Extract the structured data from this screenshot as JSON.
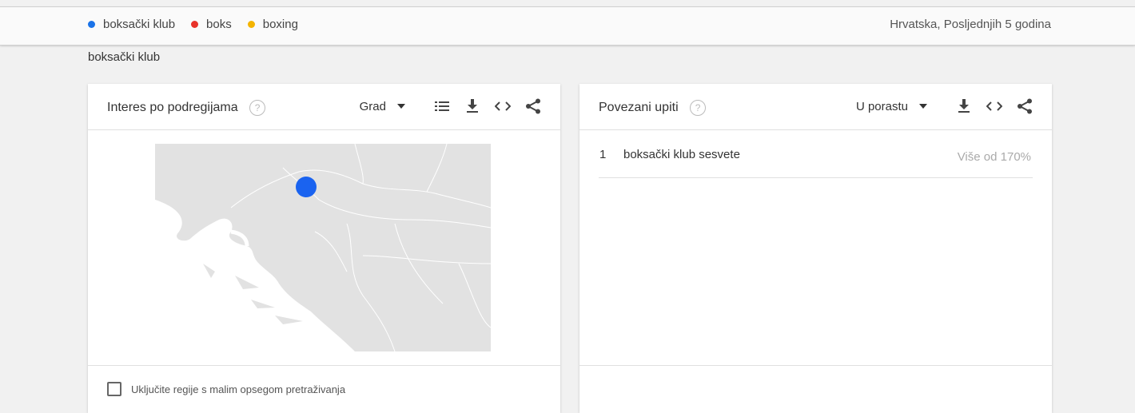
{
  "legend": [
    {
      "label": "boksački klub",
      "color": "#1a73e8"
    },
    {
      "label": "boks",
      "color": "#e8332a"
    },
    {
      "label": "boxing",
      "color": "#f4b400"
    }
  ],
  "filter_text": "Hrvatska, Posljednjih 5 godina",
  "term_label": "boksački klub",
  "left_card": {
    "title": "Interes po podregijama",
    "help_icon": "help-circle-icon",
    "dropdown_label": "Grad",
    "icons": [
      "list-icon",
      "download-icon",
      "embed-icon",
      "share-icon"
    ],
    "map": {
      "region": "Croatia",
      "marker_color": "#1a63f0",
      "marker_icon": "location-dot"
    },
    "checkbox_label": "Uključite regije s malim opsegom pretraživanja",
    "checkbox_checked": false
  },
  "right_card": {
    "title": "Povezani upiti",
    "help_icon": "help-circle-icon",
    "dropdown_label": "U porastu",
    "icons": [
      "download-icon",
      "embed-icon",
      "share-icon"
    ],
    "queries": [
      {
        "rank": "1",
        "query": "boksački klub sesvete",
        "value": "Više od 170%"
      }
    ]
  }
}
